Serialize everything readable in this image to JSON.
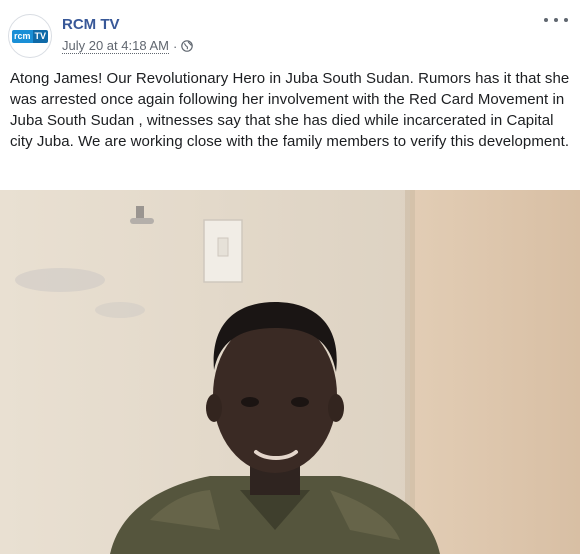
{
  "post": {
    "page_name": "RCM TV",
    "avatar": {
      "text_part1": "rcm",
      "text_part2": "TV",
      "colors": [
        "#1a8fd6",
        "#0f6aa8"
      ]
    },
    "timestamp": "July 20 at 4:18 AM",
    "separator": "·",
    "privacy_icon": "globe-icon",
    "more_icon": "more-options-icon",
    "text": "Atong James! Our Revolutionary Hero in Juba South Sudan. Rumors has it that she was arrested once again following her involvement with the Red Card Movement in Juba South Sudan , witnesses say that she has died while incarcerated in Capital city Juba. We are working close with the family members to verify this development."
  },
  "colors": {
    "link": "#385898",
    "text": "#1c1e21",
    "meta": "#616770"
  }
}
